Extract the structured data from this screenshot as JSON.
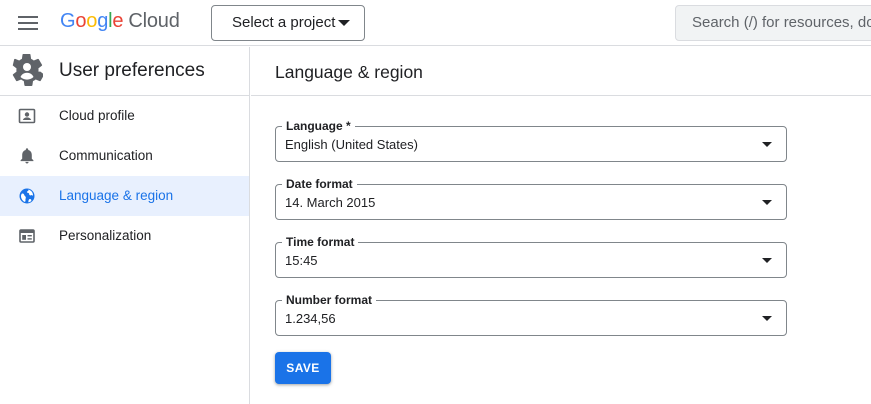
{
  "header": {
    "logo_letters": [
      "G",
      "o",
      "o",
      "g",
      "l",
      "e"
    ],
    "logo_product": "Cloud",
    "project_selector": "Select a project",
    "search_placeholder": "Search (/) for resources, docs, products, and more"
  },
  "sidebar": {
    "title": "User preferences",
    "items": [
      {
        "label": "Cloud profile",
        "icon": "profile-card-icon",
        "active": false
      },
      {
        "label": "Communication",
        "icon": "bell-icon",
        "active": false
      },
      {
        "label": "Language & region",
        "icon": "globe-icon",
        "active": true
      },
      {
        "label": "Personalization",
        "icon": "panel-icon",
        "active": false
      }
    ]
  },
  "main": {
    "title": "Language & region",
    "fields": [
      {
        "label": "Language *",
        "value": "English (United States)"
      },
      {
        "label": "Date format",
        "value": "14. March 2015"
      },
      {
        "label": "Time format",
        "value": "15:45"
      },
      {
        "label": "Number format",
        "value": "1.234,56"
      }
    ],
    "save_label": "SAVE"
  },
  "colors": {
    "accent": "#1a73e8",
    "active_bg": "#e8f0fe",
    "border": "#dadce0",
    "text": "#202124"
  }
}
